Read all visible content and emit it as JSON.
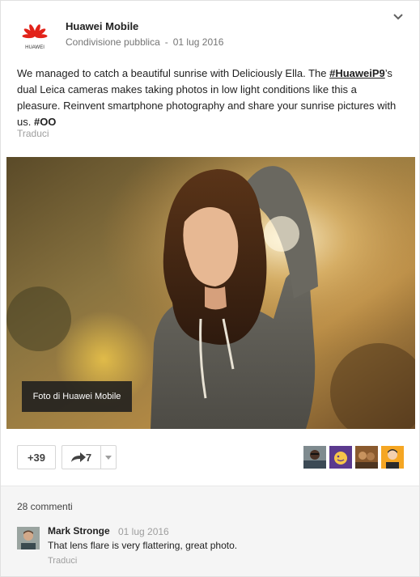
{
  "post": {
    "author": "Huawei Mobile",
    "logo_text": "HUAWEI",
    "visibility": "Condivisione pubblica",
    "separator": "-",
    "date": "01 lug 2016",
    "text_1": "We managed to catch a beautiful sunrise with Deliciously Ella. The ",
    "hashtag_1": "#HuaweiP9",
    "text_2": "’s dual Leica cameras makes taking photos in low light conditions like this a pleasure. Reinvent smartphone photography and share your sunrise pictures with us. ",
    "hashtag_2": "#OO",
    "translate_label": "Traduci"
  },
  "photo": {
    "caption": "Foto di Huawei Mobile"
  },
  "actions": {
    "plus_label": "+39",
    "share_count": "7"
  },
  "plussers": [
    "avatar-man-glasses",
    "avatar-yellow-face",
    "avatar-group-photo",
    "avatar-cartoon-man"
  ],
  "comments": {
    "count_label": "28 commenti",
    "items": [
      {
        "author": "Mark Stronge",
        "date": "01 lug 2016",
        "text": "That lens flare is very flattering, great photo.",
        "translate_label": "Traduci"
      }
    ]
  },
  "colors": {
    "brand_red": "#e2231a",
    "text_primary": "#212121",
    "text_secondary": "#757575",
    "comments_bg": "#f5f5f5"
  }
}
